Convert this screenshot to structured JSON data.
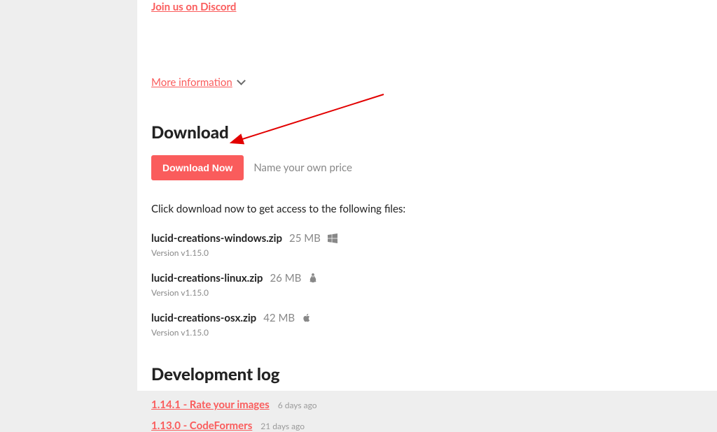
{
  "header": {
    "discord_link": "Join us on Discord",
    "more_info": "More information"
  },
  "download": {
    "heading": "Download",
    "button_label": "Download Now",
    "price_text": "Name your own price",
    "instruction": "Click download now to get access to the following files:",
    "files": [
      {
        "name": "lucid-creations-windows.zip",
        "size": "25 MB",
        "platform": "windows",
        "version": "Version v1.15.0"
      },
      {
        "name": "lucid-creations-linux.zip",
        "size": "26 MB",
        "platform": "linux",
        "version": "Version v1.15.0"
      },
      {
        "name": "lucid-creations-osx.zip",
        "size": "42 MB",
        "platform": "mac",
        "version": "Version v1.15.0"
      }
    ]
  },
  "devlog": {
    "heading": "Development log",
    "items": [
      {
        "title": "1.14.1 - Rate your images",
        "time": "6 days ago"
      },
      {
        "title": "1.13.0 - CodeFormers",
        "time": "21 days ago"
      }
    ]
  }
}
